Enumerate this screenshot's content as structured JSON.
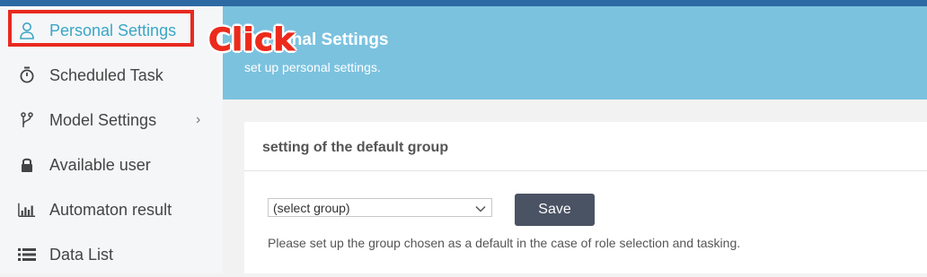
{
  "sidebar": {
    "items": [
      {
        "label": "Personal Settings",
        "icon": "user-icon",
        "active": true
      },
      {
        "label": "Scheduled Task",
        "icon": "stopwatch-icon"
      },
      {
        "label": "Model Settings",
        "icon": "branch-icon",
        "chevron": "›"
      },
      {
        "label": "Available user",
        "icon": "lock-icon"
      },
      {
        "label": "Automaton result",
        "icon": "bar-chart-icon"
      },
      {
        "label": "Data List",
        "icon": "list-icon"
      }
    ]
  },
  "header": {
    "title": "Personal Settings",
    "subtitle": "set up personal settings."
  },
  "annotation": {
    "text": "Click"
  },
  "card": {
    "title": "setting of the default group",
    "select_value": "(select group)",
    "save_label": "Save",
    "help_text": "Please set up the group chosen as a default in the case of role selection and tasking."
  },
  "colors": {
    "active": "#3aa6c6",
    "header": "#7bc2df",
    "annotation": "#e8291f",
    "button": "#4a5363"
  }
}
